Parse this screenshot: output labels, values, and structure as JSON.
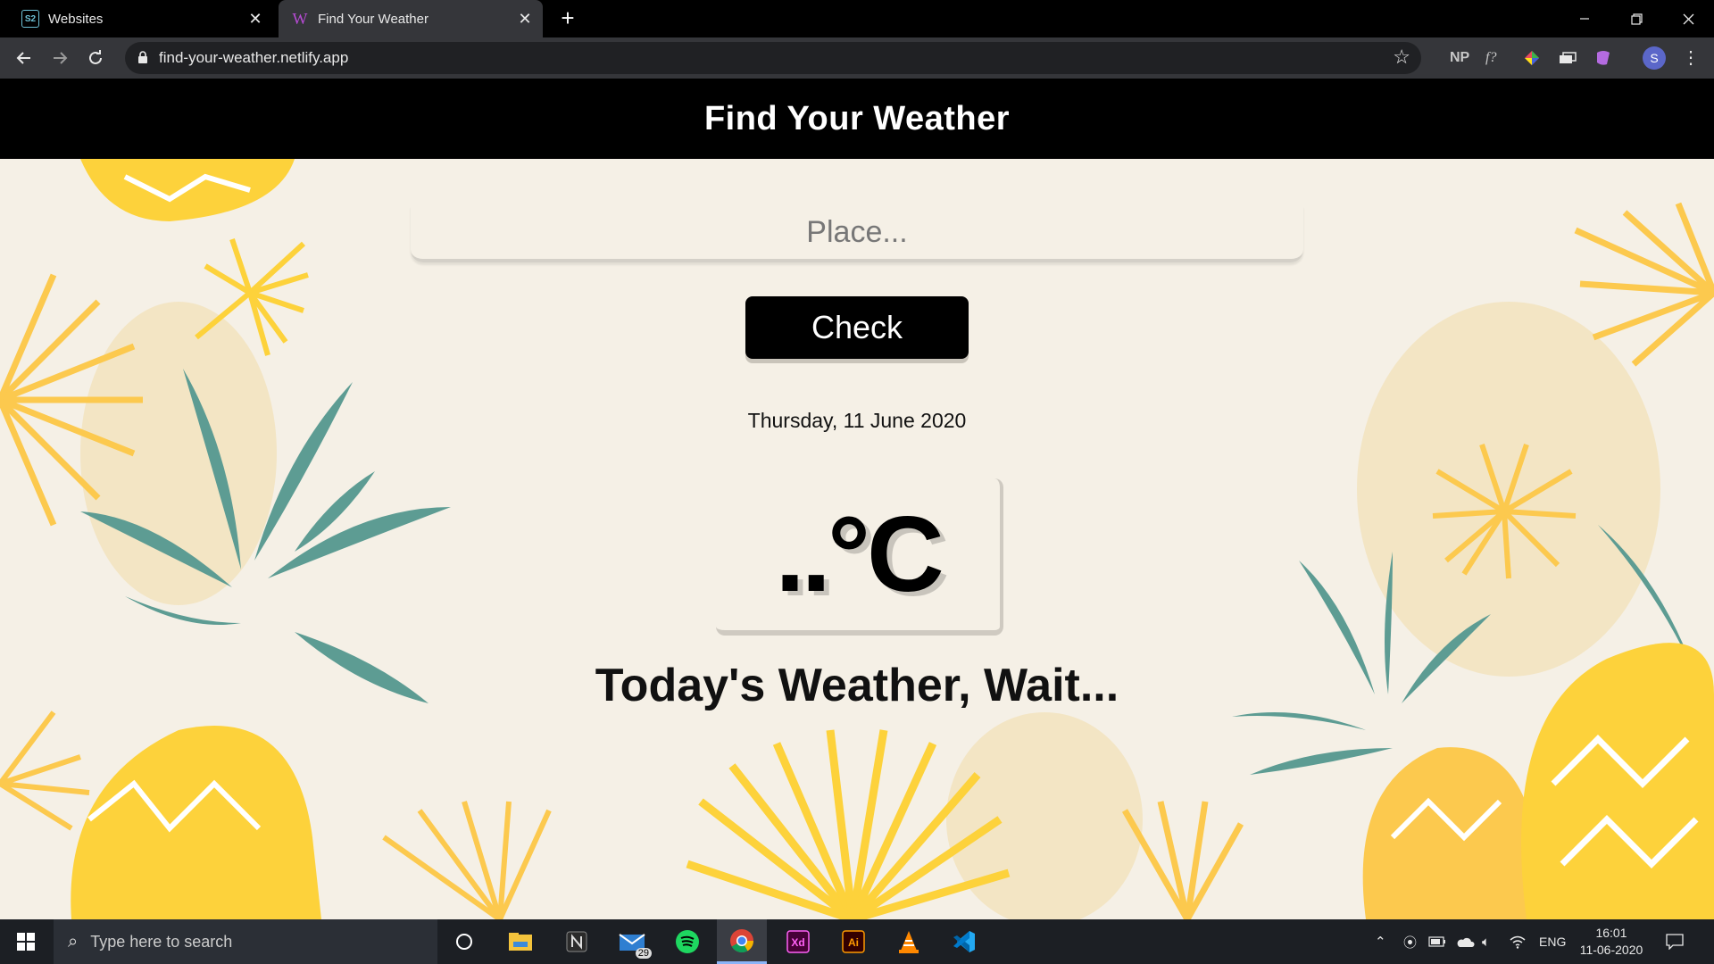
{
  "browser": {
    "tabs": [
      {
        "favicon": "S2",
        "title": "Websites",
        "close": "✕"
      },
      {
        "favicon": "W",
        "title": "Find Your Weather",
        "close": "✕"
      }
    ],
    "new_tab": "+",
    "url": "find-your-weather.netlify.app",
    "extensions": {
      "np": "NP",
      "f": "f?"
    },
    "profile_initial": "S"
  },
  "site": {
    "title": "Find Your Weather",
    "place_placeholder": "Place...",
    "check_label": "Check",
    "date": "Thursday, 11 June 2020",
    "temperature": "..°C",
    "status": "Today's Weather, Wait..."
  },
  "taskbar": {
    "search_placeholder": "Type here to search",
    "mail_badge": "29",
    "language": "ENG",
    "time": "16:01",
    "date": "11-06-2020"
  },
  "colors": {
    "page_bg": "#f5f0e6",
    "header_bg": "#000000",
    "pineapple_yellow": "#fdd23b",
    "pineapple_orange": "#fcbf52",
    "leaf_teal": "#5d9c93",
    "blob_cream": "#f3e3bd"
  }
}
